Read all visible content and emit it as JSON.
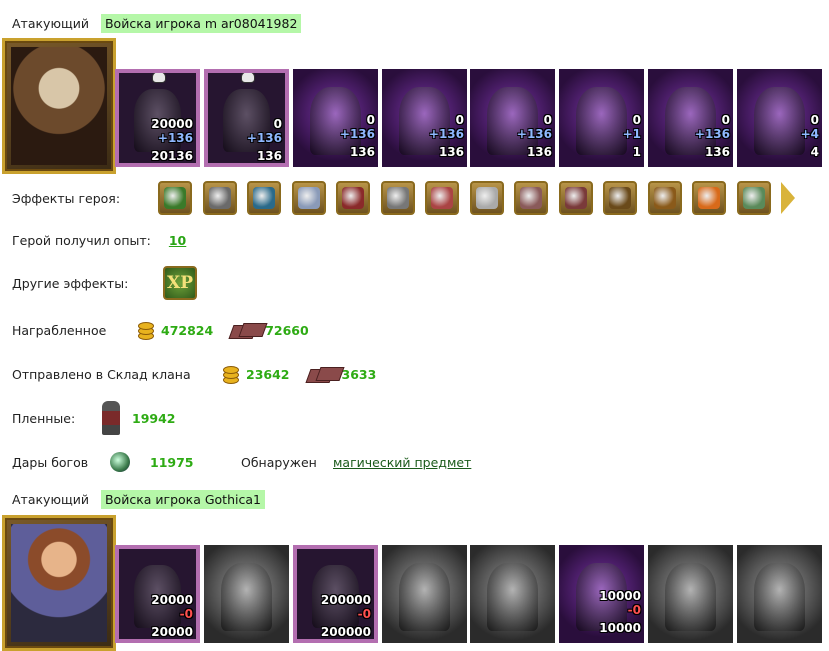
{
  "battle1": {
    "role": "Атакующий",
    "army": "Войска игрока m ar08041982",
    "units": [
      {
        "n1": "20000",
        "n2": "+136",
        "n3": "20136",
        "style": "framed"
      },
      {
        "n1": "0",
        "n2": "+136",
        "n3": "136",
        "style": "framed"
      },
      {
        "n1": "0",
        "n2": "+136",
        "n3": "136",
        "style": "purple"
      },
      {
        "n1": "0",
        "n2": "+136",
        "n3": "136",
        "style": "purple"
      },
      {
        "n1": "0",
        "n2": "+136",
        "n3": "136",
        "style": "purple"
      },
      {
        "n1": "0",
        "n2": "+1",
        "n3": "1",
        "style": "purple"
      },
      {
        "n1": "0",
        "n2": "+136",
        "n3": "136",
        "style": "purple"
      },
      {
        "n1": "0",
        "n2": "+4",
        "n3": "4",
        "style": "purple"
      }
    ],
    "hero_effects_label": "Эффекты героя:",
    "effects": [
      "helmet-icon",
      "armor-icon",
      "gem-icon",
      "gauntlet-icon",
      "scroll-icon",
      "coil-icon",
      "ring-icon",
      "chain-icon",
      "wand-icon",
      "amulet-icon",
      "boot-icon",
      "chest-icon",
      "shield-icon",
      "heart-helmet-icon"
    ],
    "exp_label": "Герой получил опыт:",
    "exp_value": "10",
    "other_effects_label": "Другие эффекты:",
    "xp_badge": "XP",
    "loot_label": "Награбленное",
    "loot_gold": "472824",
    "loot_ore": "72660",
    "clan_label": "Отправлено в Склад клана",
    "clan_gold": "23642",
    "clan_ore": "3633",
    "prisoners_label": "Пленные:",
    "prisoners_value": "19942",
    "gifts_label": "Дары богов",
    "gifts_value": "11975",
    "found_label": "Обнаружен",
    "found_link": "магический предмет"
  },
  "battle2": {
    "role": "Атакующий",
    "army": "Войска игрока Gothica1",
    "units": [
      {
        "n1": "20000",
        "n2": "-0",
        "n3": "20000",
        "style": "framed"
      },
      {
        "n1": "",
        "n2": "",
        "n3": "",
        "style": "gray"
      },
      {
        "n1": "200000",
        "n2": "-0",
        "n3": "200000",
        "style": "framed"
      },
      {
        "n1": "",
        "n2": "",
        "n3": "",
        "style": "gray"
      },
      {
        "n1": "",
        "n2": "",
        "n3": "",
        "style": "gray"
      },
      {
        "n1": "10000",
        "n2": "-0",
        "n3": "10000",
        "style": "purple"
      },
      {
        "n1": "",
        "n2": "",
        "n3": "",
        "style": "gray"
      },
      {
        "n1": "",
        "n2": "",
        "n3": "",
        "style": "gray"
      }
    ]
  }
}
